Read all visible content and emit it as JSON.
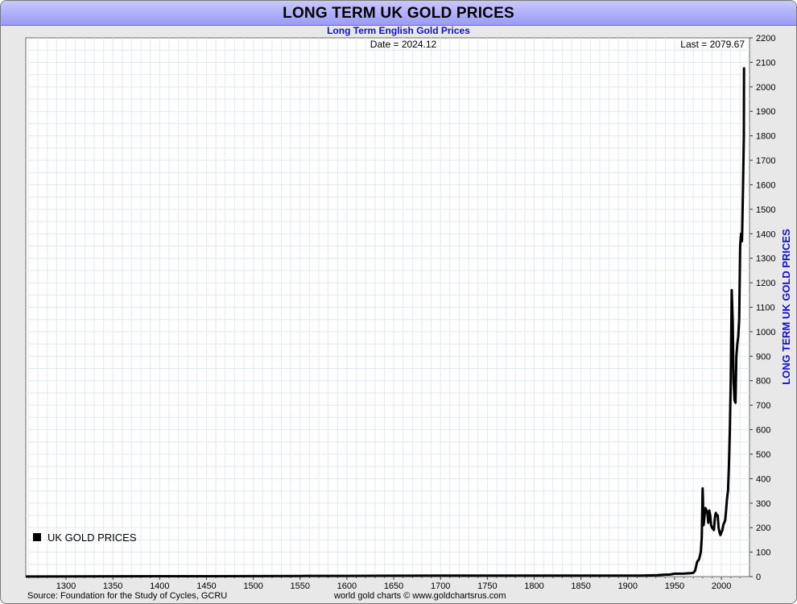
{
  "title": "LONG TERM UK GOLD PRICES",
  "subtitle": "Long Term English Gold Prices",
  "date_label": "Date = 2024.12",
  "last_label": "Last = 2079.67",
  "legend_label": "UK GOLD PRICES",
  "y_axis_title": "LONG TERM UK GOLD PRICES",
  "source": "Source: Foundation for the Study of Cycles, GCRU",
  "credit": "world gold charts © www.goldchartsrus.com",
  "colors": {
    "title_bar": "#9a9af5",
    "subtitle": "#1010d0",
    "axis_title": "#1010d0",
    "line": "#000000",
    "grid": "#e3e9f2",
    "background": "#ffffff"
  },
  "chart_data": {
    "type": "line",
    "title": "LONG TERM UK GOLD PRICES",
    "subtitle": "Long Term English Gold Prices",
    "ylabel": "LONG TERM UK GOLD PRICES",
    "xlabel": "",
    "xlim": [
      1257,
      2030
    ],
    "ylim": [
      0,
      2200
    ],
    "x_ticks": [
      1300,
      1350,
      1400,
      1450,
      1500,
      1550,
      1600,
      1650,
      1700,
      1750,
      1800,
      1850,
      1900,
      1950,
      2000
    ],
    "y_ticks": [
      0,
      100,
      200,
      300,
      400,
      500,
      600,
      700,
      800,
      900,
      1000,
      1100,
      1200,
      1300,
      1400,
      1500,
      1600,
      1700,
      1800,
      1900,
      2000,
      2100,
      2200
    ],
    "grid": true,
    "legend_position": "bottom-left",
    "y_axis_side": "right",
    "series": [
      {
        "name": "UK GOLD PRICES",
        "x": [
          1257,
          1300,
          1350,
          1400,
          1450,
          1500,
          1550,
          1600,
          1650,
          1700,
          1750,
          1800,
          1850,
          1900,
          1914,
          1931,
          1939,
          1945,
          1950,
          1960,
          1967,
          1970,
          1972,
          1974,
          1976,
          1977,
          1978,
          1979,
          1980,
          1980.5,
          1981,
          1982,
          1983,
          1984,
          1985,
          1986,
          1987,
          1988,
          1989,
          1990,
          1991,
          1992,
          1993,
          1994,
          1995,
          1996,
          1997,
          1998,
          1999,
          2000,
          2001,
          2002,
          2003,
          2004,
          2005,
          2006,
          2007,
          2008,
          2009,
          2010,
          2011,
          2012,
          2013,
          2014,
          2015,
          2016,
          2017,
          2018,
          2019,
          2020,
          2021,
          2022,
          2023,
          2024,
          2024.12
        ],
        "values": [
          0.3,
          0.8,
          1.2,
          1.5,
          1.8,
          2,
          2.5,
          3,
          3.5,
          4,
          4,
          4.2,
          4.2,
          4.2,
          4.2,
          6,
          8,
          8.5,
          12,
          12.5,
          14,
          15,
          25,
          60,
          70,
          85,
          100,
          160,
          360,
          280,
          210,
          250,
          280,
          270,
          260,
          220,
          270,
          250,
          210,
          200,
          195,
          190,
          240,
          260,
          250,
          250,
          200,
          180,
          170,
          180,
          190,
          210,
          220,
          230,
          270,
          320,
          350,
          450,
          600,
          800,
          1170,
          1050,
          800,
          720,
          710,
          900,
          950,
          980,
          1050,
          1350,
          1400,
          1370,
          1580,
          1800,
          2079.67
        ]
      }
    ]
  }
}
